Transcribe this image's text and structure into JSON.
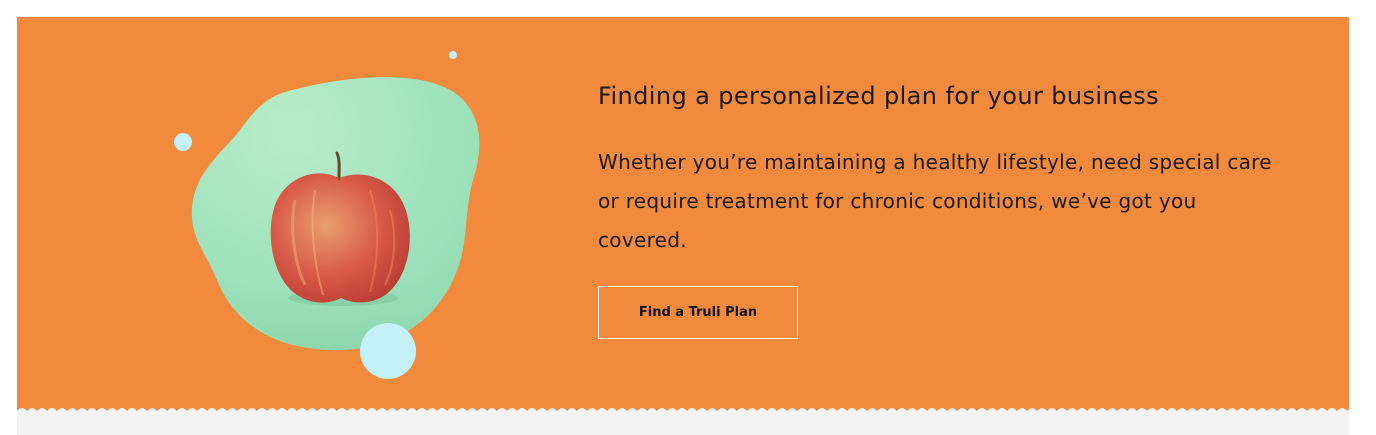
{
  "promo": {
    "heading": "Finding a personalized plan for your business",
    "body": "Whether you’re maintaining a healthy lifestyle, need special care or require treatment for chronic conditions, we’ve got you covered.",
    "cta_label": "Find a Truli Plan"
  },
  "colors": {
    "banner_background": "#f28a3e",
    "blob_green": "#a8e6c4",
    "bubble_cyan": "#c3f1f5",
    "footer_strip": "#f3f3f3"
  },
  "illustration": {
    "subject": "apple-illustration"
  }
}
